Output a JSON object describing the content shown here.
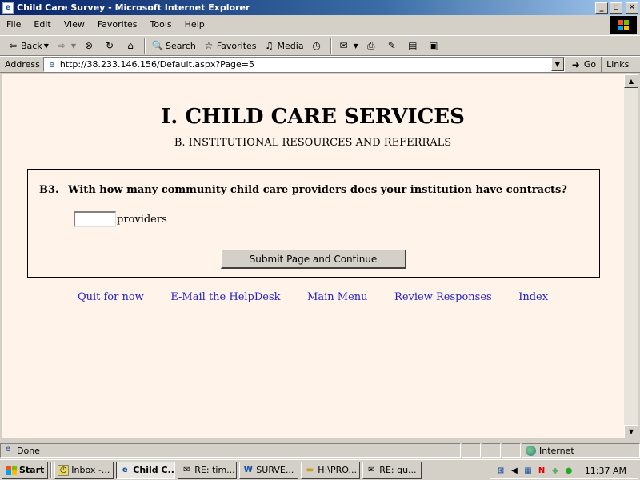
{
  "window": {
    "title": "Child Care Survey - Microsoft Internet Explorer",
    "minimize": "_",
    "maximize": "▫",
    "close": "✕"
  },
  "menu": [
    "File",
    "Edit",
    "View",
    "Favorites",
    "Tools",
    "Help"
  ],
  "toolbar": {
    "back": "Back",
    "search": "Search",
    "favorites": "Favorites",
    "media": "Media"
  },
  "address": {
    "label": "Address",
    "url": "http://38.233.146.156/Default.aspx?Page=5",
    "go": "Go",
    "links": "Links"
  },
  "page": {
    "heading": "I. CHILD CARE SERVICES",
    "subheading": "B. INSTITUTIONAL RESOURCES AND REFERRALS",
    "question": {
      "number": "B3.",
      "text": "With how many community child care providers does your institution have contracts?",
      "input_value": "",
      "unit": "providers"
    },
    "submit": "Submit Page and Continue",
    "nav_links": [
      "Quit for now",
      "E-Mail the HelpDesk",
      "Main Menu",
      "Review Responses",
      "Index"
    ]
  },
  "status": {
    "text": "Done",
    "zone": "Internet"
  },
  "taskbar": {
    "start": "Start",
    "tasks": [
      {
        "label": "Inbox -...",
        "icon": "outlook-icon",
        "active": false
      },
      {
        "label": "Child C...",
        "icon": "ie-icon",
        "active": true
      },
      {
        "label": "RE: tim...",
        "icon": "mail-icon",
        "active": false
      },
      {
        "label": "SURVE...",
        "icon": "word-icon",
        "active": false
      },
      {
        "label": "H:\\PRO...",
        "icon": "folder-icon",
        "active": false
      },
      {
        "label": "RE: qu...",
        "icon": "mail-icon",
        "active": false
      }
    ],
    "clock": "11:37 AM"
  },
  "colors": {
    "titlebar_start": "#0a246a",
    "titlebar_end": "#a6caf0",
    "content_bg": "#fff3ea",
    "link": "#2222cc",
    "chrome": "#d4d0c8"
  }
}
